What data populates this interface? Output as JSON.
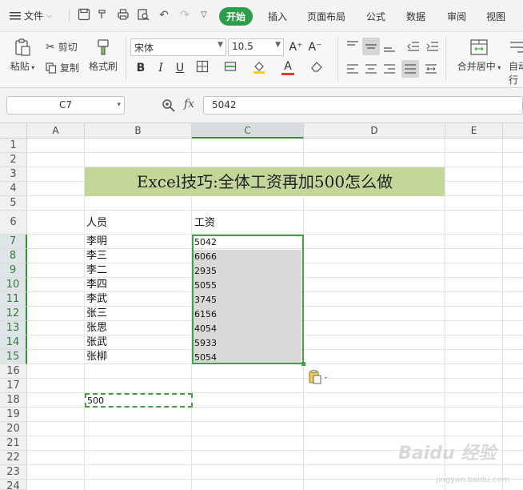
{
  "menubar": {
    "file_label": "文件",
    "tabs": [
      {
        "label": "开始",
        "active": true
      },
      {
        "label": "插入",
        "active": false
      },
      {
        "label": "页面布局",
        "active": false
      },
      {
        "label": "公式",
        "active": false
      },
      {
        "label": "数据",
        "active": false
      },
      {
        "label": "审阅",
        "active": false
      },
      {
        "label": "视图",
        "active": false
      }
    ],
    "quick_icons": [
      "save-icon",
      "format-painter-icon",
      "print-icon",
      "print-preview-icon",
      "undo-icon",
      "redo-icon",
      "customize-icon"
    ]
  },
  "ribbon": {
    "paste_label": "粘贴",
    "cut_label": "剪切",
    "copy_label": "复制",
    "format_painter_label": "格式刷",
    "font_name": "宋体",
    "font_size": "10.5",
    "merge_label": "合并居中",
    "autowrap_label": "自动换行",
    "bold_label": "B",
    "italic_label": "I",
    "underline_label": "U",
    "increase_font_label": "A⁺",
    "decrease_font_label": "A⁻",
    "font_color_label": "A"
  },
  "formula_bar": {
    "name_box": "C7",
    "fx_label": "fx",
    "formula": "5042"
  },
  "sheet": {
    "columns": [
      "A",
      "B",
      "C",
      "D",
      "E"
    ],
    "selected_column": "C",
    "rows": [
      "1",
      "2",
      "3",
      "4",
      "5",
      "6",
      "7",
      "8",
      "9",
      "10",
      "11",
      "12",
      "13",
      "14",
      "15",
      "16",
      "17",
      "18",
      "19",
      "20",
      "21",
      "22",
      "23",
      "24"
    ],
    "title": "Excel技巧:全体工资再加500怎么做",
    "header_person": "人员",
    "header_salary": "工资",
    "people": [
      "李明",
      "李三",
      "李二",
      "李四",
      "李武",
      "张三",
      "张思",
      "张武",
      "张柳"
    ],
    "salaries": [
      "5042",
      "6066",
      "2935",
      "5055",
      "3745",
      "6156",
      "4054",
      "5933",
      "5054"
    ],
    "copied_value": "500"
  },
  "colors": {
    "accent_green": "#2e9d4a",
    "title_fill": "#c4d79b",
    "selection_border": "#43a047",
    "selection_fill": "#d9d9d9"
  },
  "watermark": {
    "brand": "Baidu 经验",
    "url": "jingyan.baidu.com"
  }
}
